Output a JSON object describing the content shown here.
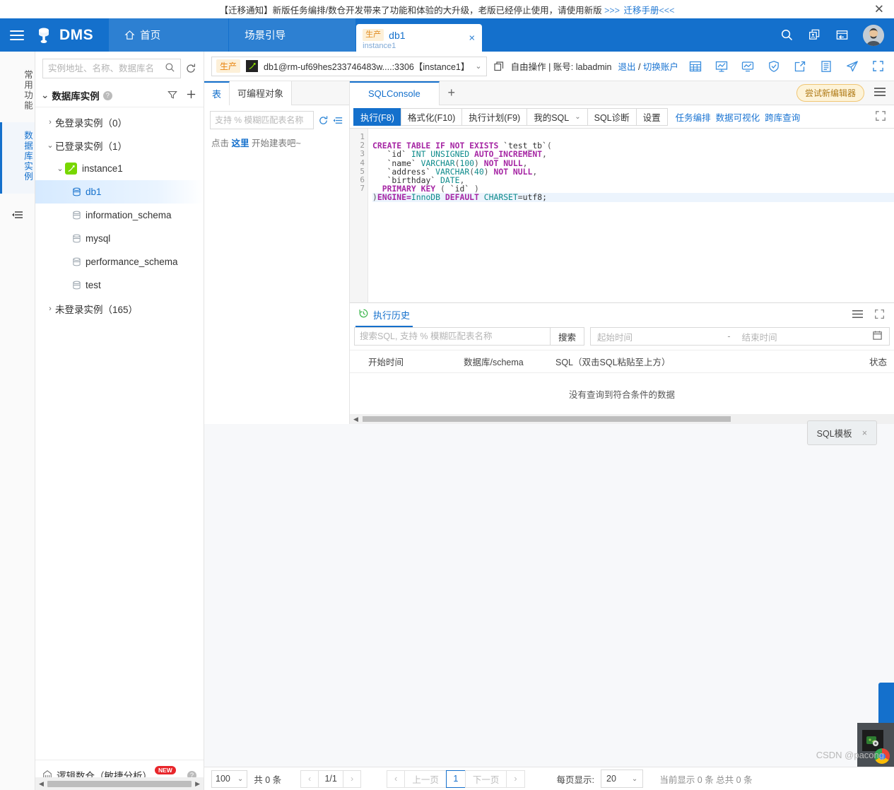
{
  "notice": {
    "text": "【迁移通知】新版任务编排/数仓开发带来了功能和体验的大升级，老版已经停止使用，请使用新版 ",
    "arrows_left": ">>> ",
    "link": "迁移手册",
    "arrows_right": "<<<",
    "close_icon": "close-icon"
  },
  "header": {
    "brand": "DMS",
    "menu_icon": "hamburger-icon",
    "tabs": [
      {
        "label": "首页",
        "icon": "home-icon"
      },
      {
        "label": "场景引导",
        "icon": ""
      }
    ],
    "doc_tab": {
      "badge": "生产",
      "title": "db1",
      "subtitle": "instance1",
      "close": "×"
    },
    "icons": [
      "search-icon",
      "windows-icon",
      "logout-icon"
    ],
    "avatar": "user-avatar"
  },
  "rail": {
    "items": [
      {
        "label": "常用功能",
        "active": false
      },
      {
        "label": "数据库实例",
        "active": true
      }
    ],
    "collapse_icon": "collapse-icon"
  },
  "tree": {
    "search_placeholder": "实例地址、名称、数据库名",
    "search_value": "",
    "search_icon": "search-icon",
    "refresh_icon": "refresh-icon",
    "section_title": "数据库实例",
    "filter_icon": "filter-icon",
    "add_icon": "plus-icon",
    "nodes": [
      {
        "label": "免登录实例（0）",
        "level": 0,
        "caret": "›",
        "type": "group"
      },
      {
        "label": "已登录实例（1）",
        "level": 0,
        "caret": "⌄",
        "type": "group"
      },
      {
        "label": "instance1",
        "level": 1,
        "caret": "⌄",
        "type": "instance"
      },
      {
        "label": "db1",
        "level": 2,
        "caret": "",
        "type": "db",
        "selected": true
      },
      {
        "label": "information_schema",
        "level": 2,
        "caret": "",
        "type": "db"
      },
      {
        "label": "mysql",
        "level": 2,
        "caret": "",
        "type": "db"
      },
      {
        "label": "performance_schema",
        "level": 2,
        "caret": "",
        "type": "db"
      },
      {
        "label": "test",
        "level": 2,
        "caret": "",
        "type": "db"
      },
      {
        "label": "未登录实例（165）",
        "level": 0,
        "caret": "›",
        "type": "group"
      }
    ],
    "footer_label": "逻辑数仓（敏捷分析）",
    "footer_badge": "NEW",
    "footer_help": "?"
  },
  "conn_bar": {
    "env": "生产",
    "engine_icon": "mysql-icon",
    "connection": "db1@rm-uf69hes233746483w....:3306【instance1】",
    "dropdown_caret": "⌄",
    "copy_icon": "copy-icon",
    "mode_label": "自由操作 | 账号: labadmin",
    "logout": "退出",
    "divider": " / ",
    "switch_account": "切换账户",
    "icons": [
      "table-icon",
      "dashboard-icon",
      "monitor-icon",
      "shield-check-icon",
      "export-icon",
      "document-icon",
      "send-icon",
      "fullscreen-icon"
    ]
  },
  "tables_panel": {
    "tabs": [
      {
        "label": "表",
        "active": true
      },
      {
        "label": "可编程对象",
        "active": false
      }
    ],
    "search_placeholder": "支持 % 模糊匹配表名称",
    "search_value": "",
    "refresh_icon": "refresh-icon",
    "sort_icon": "sort-icon",
    "hint_prefix": "点击 ",
    "hint_link": "这里",
    "hint_suffix": " 开始建表吧~",
    "footer": {
      "page_size": "100",
      "total": "共 0 条",
      "prev_icon": "‹",
      "page_info": "1/1",
      "next_icon": "›"
    }
  },
  "editor": {
    "tabs": [
      {
        "label": "SQLConsole",
        "active": true
      }
    ],
    "add_tab": "+",
    "try_new_editor": "尝试新编辑器",
    "menu_icon": "menu-icon",
    "toolbar_buttons": [
      {
        "label": "执行(F8)",
        "primary": true
      },
      {
        "label": "格式化(F10)",
        "primary": false
      },
      {
        "label": "执行计划(F9)",
        "primary": false
      },
      {
        "label": "我的SQL",
        "primary": false,
        "caret": "⌄"
      },
      {
        "label": "SQL诊断",
        "primary": false
      },
      {
        "label": "设置",
        "primary": false
      }
    ],
    "toolbar_links": [
      "任务编排",
      "数据可视化",
      "跨库查询"
    ],
    "fullscreen_icon": "fullscreen-icon",
    "line_numbers": [
      "1",
      "2",
      "3",
      "4",
      "5",
      "6",
      "7"
    ],
    "sql_lines": [
      "CREATE TABLE IF NOT EXISTS `test_tb`(",
      "   `id` INT UNSIGNED AUTO_INCREMENT,",
      "   `name` VARCHAR(100) NOT NULL,",
      "   `address` VARCHAR(40) NOT NULL,",
      "   `birthday` DATE,",
      "  PRIMARY KEY ( `id` )",
      ")ENGINE=InnoDB DEFAULT CHARSET=utf8;"
    ],
    "current_line": 7
  },
  "history": {
    "tab_label": "执行历史",
    "history_icon": "history-icon",
    "menu_icon": "list-icon",
    "fullscreen_icon": "fullscreen-icon",
    "search_placeholder": "搜索SQL, 支持 % 模糊匹配表名称",
    "search_value": "",
    "search_button": "搜索",
    "start_time_placeholder": "起始时间",
    "range_sep": "-",
    "end_time_placeholder": "结束时间",
    "calendar_icon": "calendar-icon",
    "columns": [
      "开始时间",
      "数据库/schema",
      "SQL（双击SQL粘贴至上方）",
      "状态"
    ],
    "empty_text": "没有查询到符合条件的数据"
  },
  "sql_template": {
    "label": "SQL模板",
    "close": "×"
  },
  "footer": {
    "prev_page": "上一页",
    "page": "1",
    "next_page": "下一页",
    "prev_icon": "‹",
    "next_icon": "›",
    "page_size_label": "每页显示:",
    "page_size": "20",
    "count_text": "当前显示 0 条 总共 0 条"
  },
  "watermark": "CSDN @pacong",
  "colors": {
    "brand_blue": "#1470cc",
    "link_blue": "#1a74d2",
    "keyword_purple": "#a626a4",
    "type_teal": "#0d8b8b",
    "badge_red": "#e8262b",
    "env_orange": "#e8820c",
    "instance_green": "#78d700"
  }
}
